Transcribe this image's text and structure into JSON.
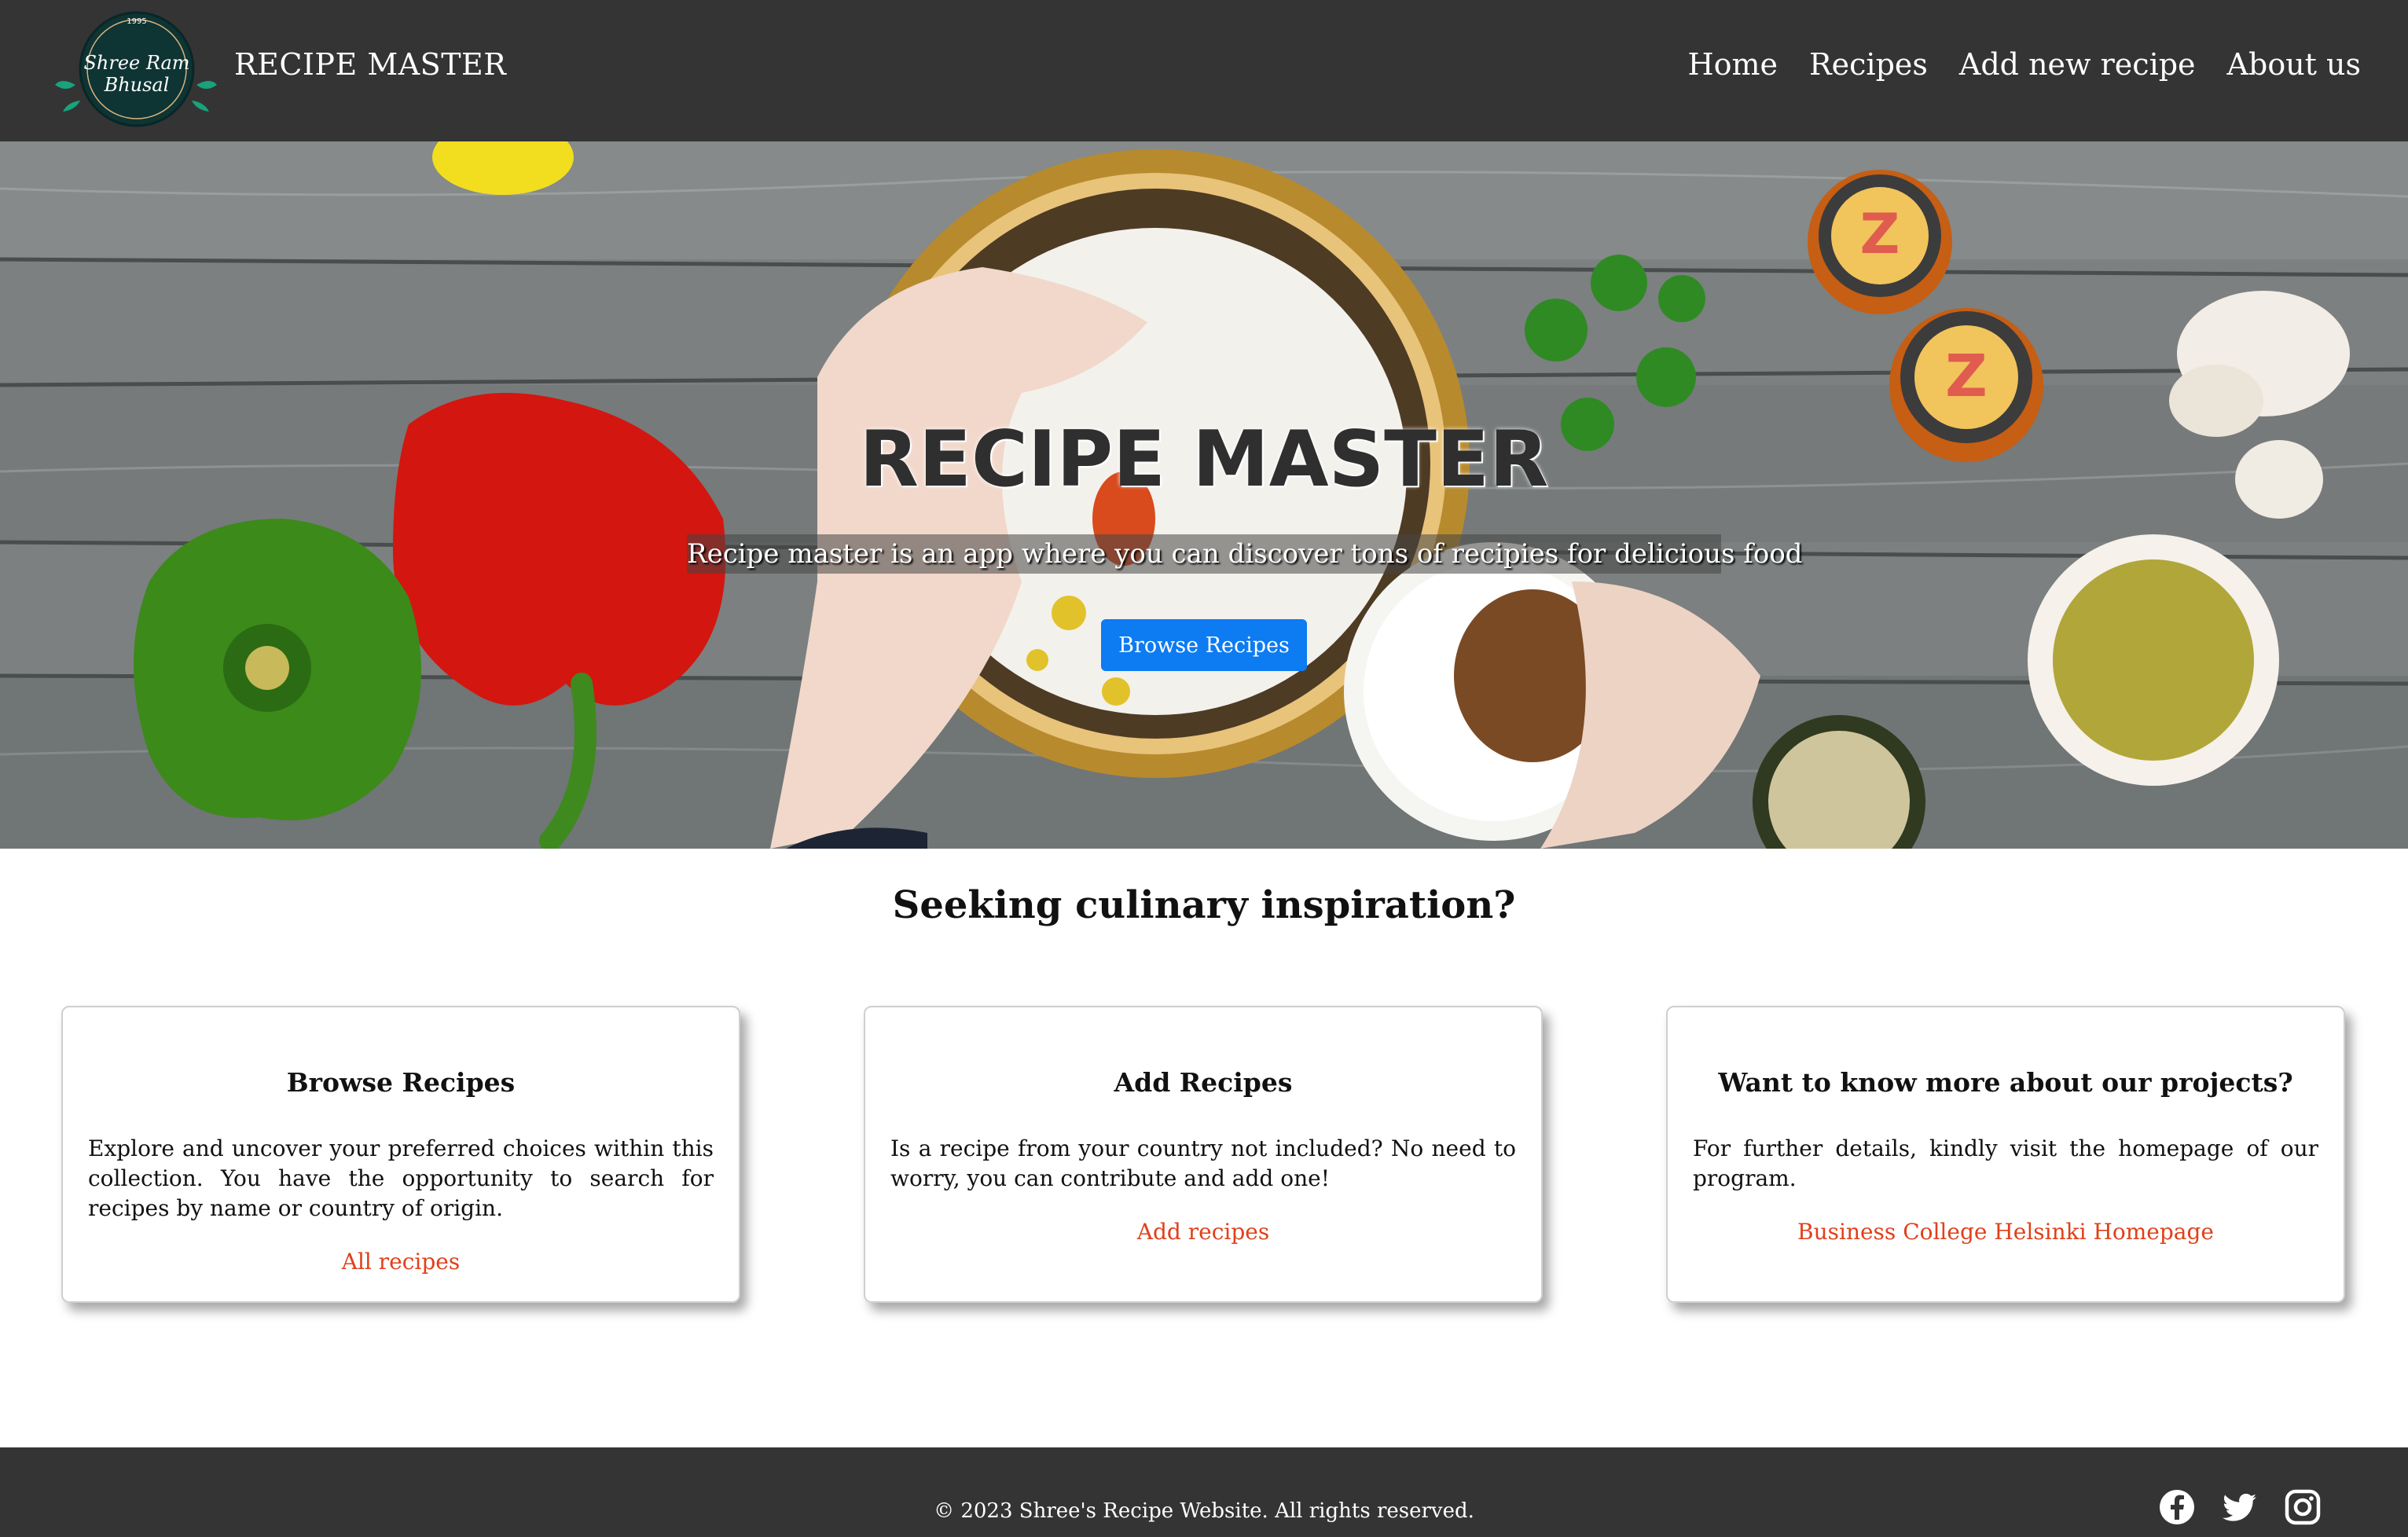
{
  "header": {
    "logo_text_line1": "Shree Ram",
    "logo_text_line2": "Bhusal",
    "logo_year": "1995",
    "brand": "RECIPE MASTER",
    "nav": [
      {
        "label": "Home"
      },
      {
        "label": "Recipes"
      },
      {
        "label": "Add new recipe"
      },
      {
        "label": "About us"
      }
    ]
  },
  "hero": {
    "title": "RECIPE MASTER",
    "subtitle": "Recipe master is an app where you can discover tons of recipies for delicious food",
    "button_label": "Browse Recipes",
    "jar_label": "Z"
  },
  "main": {
    "heading": "Seeking culinary inspiration?",
    "cards": [
      {
        "title": "Browse Recipes",
        "text": "Explore and uncover your preferred choices within this collection. You have the opportunity to search for recipes by name or country of origin.",
        "link": "All recipes"
      },
      {
        "title": "Add Recipes",
        "text": "Is a recipe from your country not included? No need to worry, you can contribute and add one!",
        "link": "Add recipes"
      },
      {
        "title": "Want to know more about our projects?",
        "text": "For further details, kindly visit the homepage of our program.",
        "link": "Business College Helsinki Homepage"
      }
    ]
  },
  "footer": {
    "copyright": "© 2023 Shree's Recipe Website. All rights reserved.",
    "social": [
      "facebook-icon",
      "twitter-icon",
      "instagram-icon"
    ]
  },
  "colors": {
    "header_bg": "#343434",
    "primary_button": "#0d7bf2",
    "link": "#e0401a"
  }
}
